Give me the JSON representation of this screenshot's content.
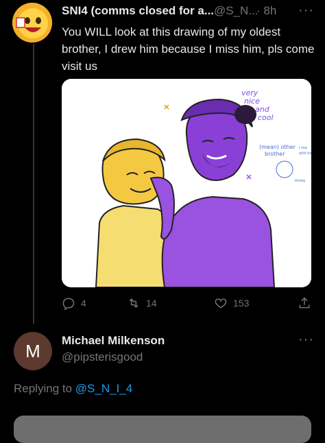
{
  "tweet": {
    "display_name": "SNI4 (comms closed for a...",
    "handle": "@S_N...",
    "time": "· 8h",
    "more_icon": "more-icon",
    "text": "You WILL look at this drawing of my oldest brother, I drew him because I miss him, pls come visit us",
    "image": {
      "annotations": {
        "top": "very nice and cool",
        "side": "(mean) other brother",
        "small_1": "I live with him",
        "small_2": "thinky"
      }
    },
    "actions": {
      "reply_count": "4",
      "retweet_count": "14",
      "like_count": "153"
    }
  },
  "reply": {
    "avatar_letter": "M",
    "avatar_color": "#5c3a2e",
    "display_name": "Michael Milkenson",
    "handle": "@pipsterisgood",
    "replying_prefix": "Replying to",
    "replying_handle": "@S_N_I_4"
  },
  "colors": {
    "accent": "#1d9bf0",
    "muted": "#71767b",
    "background": "#000000"
  }
}
